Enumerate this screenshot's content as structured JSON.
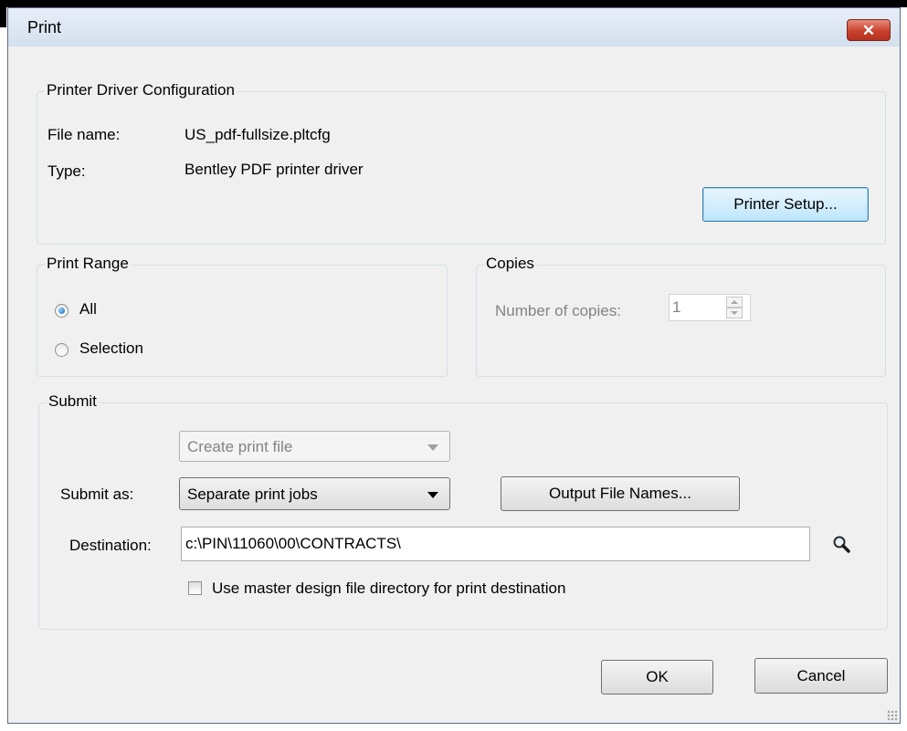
{
  "window": {
    "title": "Print",
    "close_glyph": "✕"
  },
  "printer_config": {
    "legend": "Printer Driver Configuration",
    "file_name_label": "File name:",
    "file_name_value": "US_pdf-fullsize.pltcfg",
    "type_label": "Type:",
    "type_value": "Bentley PDF printer driver",
    "setup_button": "Printer Setup..."
  },
  "print_range": {
    "legend": "Print Range",
    "options": [
      {
        "label": "All",
        "selected": true
      },
      {
        "label": "Selection",
        "selected": false
      }
    ]
  },
  "copies": {
    "legend": "Copies",
    "label": "Number of copies:",
    "value": "1"
  },
  "submit": {
    "legend": "Submit",
    "print_file_combo": "Create print file",
    "submit_as_label": "Submit as:",
    "submit_as_value": "Separate print jobs",
    "output_button": "Output File Names...",
    "destination_label": "Destination:",
    "destination_value": "c:\\PIN\\11060\\00\\CONTRACTS\\",
    "master_checkbox_label": "Use master design file directory for print destination",
    "master_checked": false
  },
  "footer": {
    "ok": "OK",
    "cancel": "Cancel"
  },
  "icons": {
    "close": "close-icon",
    "browse": "magnifier-icon",
    "resize": "resize-grip-icon"
  }
}
